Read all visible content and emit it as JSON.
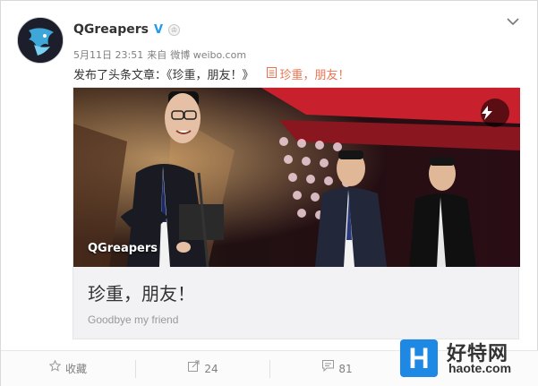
{
  "post": {
    "username": "QGreapers",
    "verified_badge": "V",
    "crown_badge": "♔",
    "date": "5月11日 23:51",
    "source_prefix": "来自",
    "source": "微博 weibo.com",
    "text": "发布了头条文章：《珍重，朋友！》",
    "article_link_icon": "document-icon",
    "article_link_text": "珍重，朋友！"
  },
  "embed": {
    "photo_caption": "QGreapers",
    "title": "珍重，朋友！",
    "subtitle": "Goodbye my friend",
    "flash_icon": "lightning-icon"
  },
  "actions": {
    "favorite_label": "收藏",
    "repost_count": "24",
    "comment_count": "81",
    "like_count": ""
  },
  "watermark": {
    "logo_letter": "H",
    "name": "好特网",
    "url": "haote.com"
  },
  "colors": {
    "link": "#eb7350",
    "verified": "#1d9bf0",
    "watermark_blue": "#1e88e5"
  }
}
